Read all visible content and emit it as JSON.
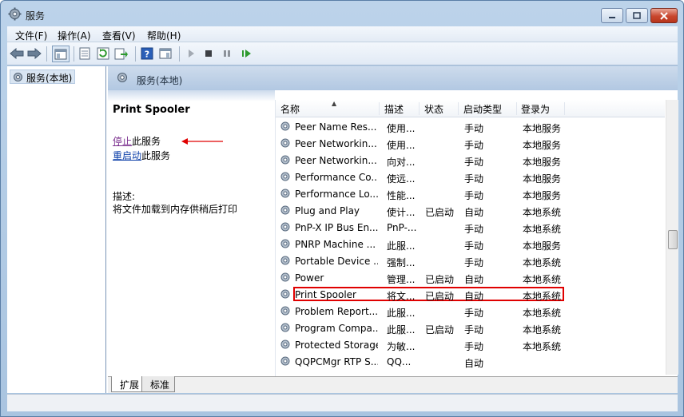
{
  "window": {
    "title": "服务"
  },
  "menu": [
    "文件(F)",
    "操作(A)",
    "查看(V)",
    "帮助(H)"
  ],
  "tree": {
    "root_label": "服务(本地)"
  },
  "pane": {
    "header": "服务(本地)"
  },
  "detail": {
    "service_name": "Print Spooler",
    "stop_link": "停止",
    "stop_suffix": "此服务",
    "restart_link": "重启动",
    "restart_suffix": "此服务",
    "desc_label": "描述:",
    "desc_text": "将文件加载到内存供稍后打印"
  },
  "columns": {
    "name": "名称",
    "desc": "描述",
    "status": "状态",
    "startup": "启动类型",
    "logon": "登录为"
  },
  "rows": [
    {
      "name": "Peer Name Res...",
      "desc": "使用...",
      "status": "",
      "startup": "手动",
      "logon": "本地服务"
    },
    {
      "name": "Peer Networkin...",
      "desc": "使用...",
      "status": "",
      "startup": "手动",
      "logon": "本地服务"
    },
    {
      "name": "Peer Networkin...",
      "desc": "向对...",
      "status": "",
      "startup": "手动",
      "logon": "本地服务"
    },
    {
      "name": "Performance Co...",
      "desc": "使远...",
      "status": "",
      "startup": "手动",
      "logon": "本地服务"
    },
    {
      "name": "Performance Lo...",
      "desc": "性能...",
      "status": "",
      "startup": "手动",
      "logon": "本地服务"
    },
    {
      "name": "Plug and Play",
      "desc": "使计...",
      "status": "已启动",
      "startup": "自动",
      "logon": "本地系统"
    },
    {
      "name": "PnP-X IP Bus En...",
      "desc": "PnP-...",
      "status": "",
      "startup": "手动",
      "logon": "本地系统"
    },
    {
      "name": "PNRP Machine ...",
      "desc": "此服...",
      "status": "",
      "startup": "手动",
      "logon": "本地服务"
    },
    {
      "name": "Portable Device ...",
      "desc": "强制...",
      "status": "",
      "startup": "手动",
      "logon": "本地系统"
    },
    {
      "name": "Power",
      "desc": "管理...",
      "status": "已启动",
      "startup": "自动",
      "logon": "本地系统"
    },
    {
      "name": "Print Spooler",
      "desc": "将文...",
      "status": "已启动",
      "startup": "自动",
      "logon": "本地系统"
    },
    {
      "name": "Problem Report...",
      "desc": "此服...",
      "status": "",
      "startup": "手动",
      "logon": "本地系统"
    },
    {
      "name": "Program Compa...",
      "desc": "此服...",
      "status": "已启动",
      "startup": "手动",
      "logon": "本地系统"
    },
    {
      "name": "Protected Storage",
      "desc": "为敏...",
      "status": "",
      "startup": "手动",
      "logon": "本地系统"
    },
    {
      "name": "QQPCMgr RTP S...",
      "desc": "QQ...",
      "status": "",
      "startup": "自动",
      "logon": ""
    }
  ],
  "tabs": [
    "扩展",
    "标准"
  ],
  "icons": [
    "back-arrow-icon",
    "forward-arrow-icon",
    "console-tree-icon",
    "properties-icon",
    "refresh-icon",
    "export-icon",
    "help-icon",
    "view-icon",
    "play-icon",
    "stop-icon",
    "pause-icon",
    "resume-icon",
    "gear-icon"
  ],
  "colors": {
    "highlight_border": "#e00000",
    "arrow": "#e00000",
    "link": "#0b3ea8"
  }
}
